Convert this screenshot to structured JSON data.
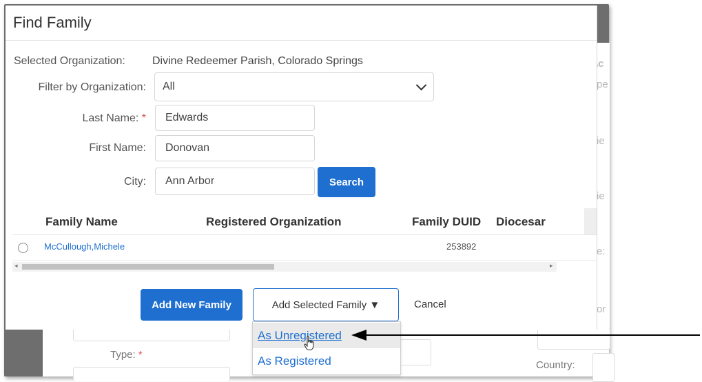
{
  "modal": {
    "title": "Find Family"
  },
  "form": {
    "selected_org_label": "Selected Organization:",
    "selected_org_value": "Divine Redeemer Parish, Colorado Springs",
    "filter_label": "Filter by Organization:",
    "filter_value": "All",
    "last_name_label": "Last Name:",
    "last_name_required": "*",
    "last_name_value": "Edwards",
    "first_name_label": "First Name:",
    "first_name_value": "Donovan",
    "city_label": "City:",
    "city_value": "Ann Arbor",
    "search_button": "Search"
  },
  "table": {
    "columns": [
      "Family Name",
      "Registered Organization",
      "Family DUID",
      "Diocesar"
    ],
    "rows": [
      {
        "family_name": "McCullough,Michele",
        "registered_org": "",
        "family_duid": "253892"
      }
    ]
  },
  "footer": {
    "add_new": "Add New Family",
    "add_selected": "Add Selected Family ▼",
    "cancel": "Cancel"
  },
  "dropdown": {
    "items": [
      "As Unregistered",
      "As Registered"
    ],
    "hovered_index": 0
  },
  "background": {
    "type_label": "Type:",
    "type_required": "*",
    "country_label": "Country:",
    "frag_1": "\\c",
    "frag_2": "pe",
    "frag_3": "ie",
    "frag_4": "ie",
    "frag_5": "e:",
    "frag_6": "or"
  },
  "colors": {
    "primary": "#1e6fd0",
    "link": "#1e6fd0",
    "required": "#d9534f"
  },
  "icons": {
    "filter_chevron": "chevron-down-icon",
    "pointer": "hand-pointer-icon",
    "annotation": "arrow-left-icon"
  }
}
